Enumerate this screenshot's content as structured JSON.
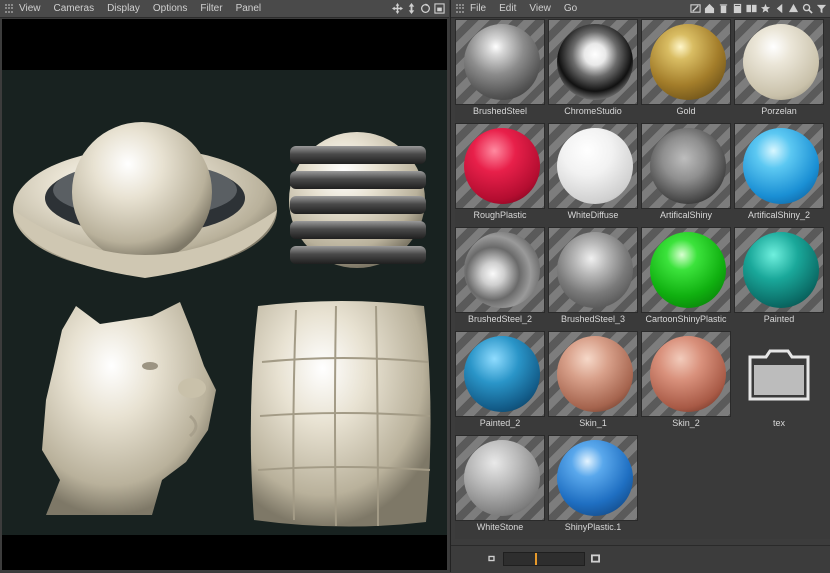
{
  "viewer": {
    "menu": [
      "View",
      "Cameras",
      "Display",
      "Options",
      "Filter",
      "Panel"
    ],
    "toolbar_icons": [
      "move-icon",
      "dolly-icon",
      "rotate-icon",
      "frame-icon"
    ]
  },
  "browser": {
    "menu": [
      "File",
      "Edit",
      "View",
      "Go"
    ],
    "toolbar_icons": [
      "edit-icon",
      "home-icon",
      "trash-icon",
      "book-icon",
      "bookmarks-icon",
      "star-icon",
      "back-icon",
      "up-icon",
      "search-icon",
      "filter-icon"
    ],
    "materials": [
      {
        "label": "BrushedSteel",
        "material": "m-brushed"
      },
      {
        "label": "ChromeStudio",
        "material": "m-chrome"
      },
      {
        "label": "Gold",
        "material": "m-gold"
      },
      {
        "label": "Porzelan",
        "material": "m-porz"
      },
      {
        "label": "RoughPlastic",
        "material": "m-rough"
      },
      {
        "label": "WhiteDiffuse",
        "material": "m-white"
      },
      {
        "label": "ArtificalShiny",
        "material": "m-artshiny"
      },
      {
        "label": "ArtificalShiny_2",
        "material": "m-artshiny2"
      },
      {
        "label": "BrushedSteel_2",
        "material": "m-brushed2"
      },
      {
        "label": "BrushedSteel_3",
        "material": "m-brushed3"
      },
      {
        "label": "CartoonShinyPlastic",
        "material": "m-cartoon"
      },
      {
        "label": "Painted",
        "material": "m-painted"
      },
      {
        "label": "Painted_2",
        "material": "m-painted2"
      },
      {
        "label": "Skin_1",
        "material": "m-skin1"
      },
      {
        "label": "Skin_2",
        "material": "m-skin2"
      },
      {
        "label": "tex",
        "material": "folder"
      },
      {
        "label": "WhiteStone",
        "material": "m-whitestone"
      },
      {
        "label": "ShinyPlastic.1",
        "material": "m-shinyplastic"
      }
    ],
    "thumbnail_size": 0.4
  },
  "colors": {
    "accent": "#e89a2a",
    "background": "#3a3a3a",
    "scene_background": "#182220"
  }
}
